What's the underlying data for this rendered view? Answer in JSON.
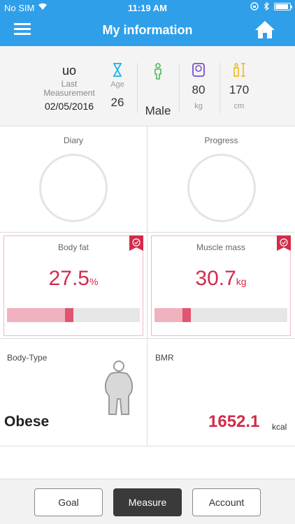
{
  "status": {
    "carrier": "No SIM",
    "time": "11:19 AM"
  },
  "header": {
    "title": "My information"
  },
  "profile": {
    "username": "uo",
    "last_label": "Last Measurement",
    "date": "02/05/2016",
    "age_label": "Age",
    "age": "26",
    "gender": "Male",
    "weight": "80",
    "weight_unit": "kg",
    "height": "170",
    "height_unit": "cm"
  },
  "cards": {
    "diary": "Diary",
    "progress": "Progress",
    "body_fat": {
      "label": "Body fat",
      "value": "27.5",
      "unit": "%",
      "level": 0.47
    },
    "muscle_mass": {
      "label": "Muscle mass",
      "value": "30.7",
      "unit": "kg",
      "level": 0.24
    },
    "body_type": {
      "label": "Body-Type",
      "value": "Obese"
    },
    "bmr": {
      "label": "BMR",
      "value": "1652.1",
      "unit": "kcal"
    }
  },
  "tabs": {
    "goal": "Goal",
    "measure": "Measure",
    "account": "Account"
  },
  "colors": {
    "header": "#2f9fe9",
    "accent": "#d12c4a",
    "bar": "#f0b2be"
  },
  "icons": {
    "menu": "hamburger-icon",
    "home": "home-icon",
    "age": "hourglass-icon",
    "gender": "person-icon",
    "weight": "scale-icon",
    "height": "height-icon",
    "badge": "check-badge-icon",
    "body": "body-figure-icon"
  }
}
